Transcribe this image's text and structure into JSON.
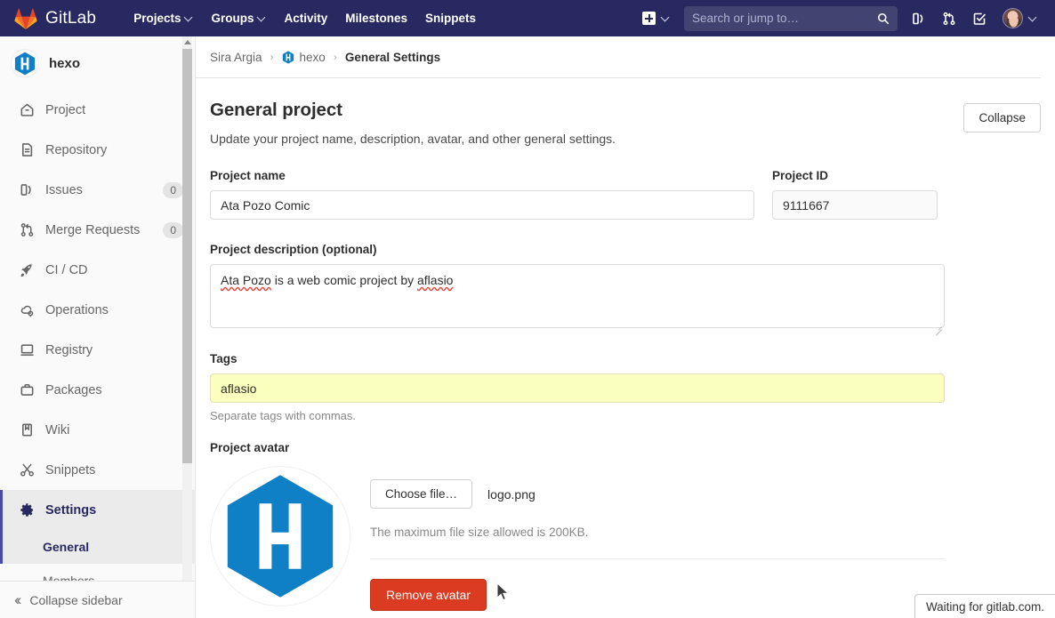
{
  "topnav": {
    "brand": "GitLab",
    "brand_icon": "gitlab-logo-icon",
    "links": [
      {
        "label": "Projects",
        "has_caret": true
      },
      {
        "label": "Groups",
        "has_caret": true
      },
      {
        "label": "Activity",
        "has_caret": false
      },
      {
        "label": "Milestones",
        "has_caret": false
      },
      {
        "label": "Snippets",
        "has_caret": false
      }
    ],
    "new_label": "",
    "search_placeholder": "Search or jump to…",
    "search_value": "",
    "icons": [
      "plus-square-icon",
      "search-icon",
      "issues-icon",
      "merge-request-icon",
      "todos-check-icon",
      "user-avatar"
    ]
  },
  "sidebar": {
    "project_name": "hexo",
    "project_avatar_letter": "H",
    "items": [
      {
        "label": "Project",
        "icon": "home-icon",
        "badge": "",
        "active": false
      },
      {
        "label": "Repository",
        "icon": "document-icon",
        "badge": "",
        "active": false
      },
      {
        "label": "Issues",
        "icon": "issues-icon",
        "badge": "0",
        "active": false
      },
      {
        "label": "Merge Requests",
        "icon": "merge-request-icon",
        "badge": "0",
        "active": false
      },
      {
        "label": "CI / CD",
        "icon": "rocket-icon",
        "badge": "",
        "active": false
      },
      {
        "label": "Operations",
        "icon": "cloud-gear-icon",
        "badge": "",
        "active": false
      },
      {
        "label": "Registry",
        "icon": "package-box-icon",
        "badge": "",
        "active": false
      },
      {
        "label": "Packages",
        "icon": "briefcase-icon",
        "badge": "",
        "active": false
      },
      {
        "label": "Wiki",
        "icon": "book-icon",
        "badge": "",
        "active": false
      },
      {
        "label": "Snippets",
        "icon": "scissors-icon",
        "badge": "",
        "active": false
      },
      {
        "label": "Settings",
        "icon": "gear-icon",
        "badge": "",
        "active": true
      }
    ],
    "sub_items": [
      {
        "label": "General",
        "active": true
      },
      {
        "label": "Members",
        "active": false
      }
    ],
    "collapse_label": "Collapse sidebar",
    "collapse_icon": "chevron-double-left-icon"
  },
  "breadcrumb": {
    "items": [
      {
        "label": "Sira Argia",
        "icon": "",
        "current": false
      },
      {
        "label": "hexo",
        "icon": "hexo-avatar-icon",
        "current": false
      },
      {
        "label": "General Settings",
        "icon": "",
        "current": true
      }
    ],
    "separator": "›"
  },
  "main": {
    "section_title": "General project",
    "section_desc": "Update your project name, description, avatar, and other general settings.",
    "collapse_button": "Collapse",
    "project_name_label": "Project name",
    "project_name_value": "Ata Pozo Comic",
    "project_id_label": "Project ID",
    "project_id_value": "9111667",
    "description_label": "Project description (optional)",
    "description_value": "Ata Pozo is a web comic project by aflasio",
    "description_misspelled": [
      "Ata Pozo",
      "aflasio"
    ],
    "description_part_1": "Ata Pozo",
    "description_part_2": " is a web comic project by ",
    "description_part_3": "aflasio",
    "tags_label": "Tags",
    "tags_value": "aflasio",
    "tags_help": "Separate tags with commas.",
    "avatar_label": "Project avatar",
    "choose_file_button": "Choose file…",
    "chosen_file_name": "logo.png",
    "file_size_help": "The maximum file size allowed is 200KB.",
    "remove_avatar_button": "Remove avatar",
    "avatar_letter": "H"
  },
  "statusbar": {
    "text": "Waiting for gitlab.com."
  },
  "colors": {
    "nav_background": "#292961",
    "search_background": "#434372",
    "accent_indigo": "#292961",
    "active_border": "#4b4ba3",
    "hexo_blue": "#1080c6",
    "danger_red": "#db3b21",
    "autofill_yellow": "#faffbd",
    "badge_gray": "#e4e4e4"
  }
}
